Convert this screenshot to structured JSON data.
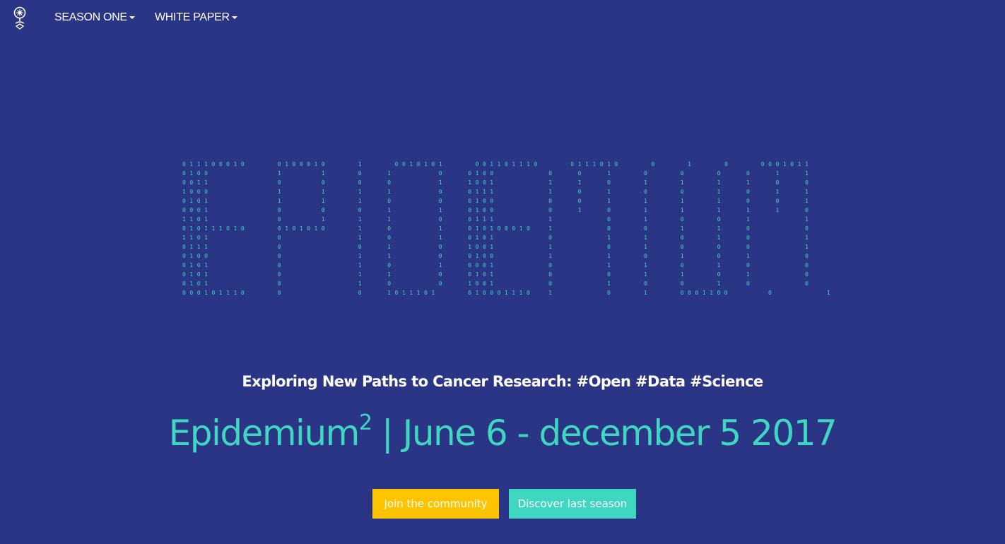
{
  "navbar": {
    "logo_icon": "epidemium-logo-icon",
    "items": [
      {
        "label": "SEASON ONE",
        "icon": "caret-down-icon"
      },
      {
        "label": "WHITE PAPER",
        "icon": "caret-down-icon"
      }
    ]
  },
  "hero": {
    "binary_rows": [
      "011100010    0100010    1    0010101    001101110    0111010    0    1    0    0001011",
      "0100         1     1    0   1      0   0100       0   0   1    0    0    0   0   1   1",
      "0011         0     0    0   0      1   1001       1   1   0    1    1    1   1   0   0",
      "1000         1     1    1   1      0   0111       1   0   1    0    0    1   0   1   1",
      "0101         1     1    1   0      0   0100       0   0   1    1    1    1   0   0   1",
      "0001         0     0    0   1      1   0100       0   1   0    1    1    1   1   1   0",
      "1101         0     1    1   1      0   0111       1       0    1    0    0   1       1",
      "010111010    0101010    1   0      1   010100010  1       0    0    1    1   0       0",
      "1101         0          1   0      1   0101       0       1    1    0    1   0       1",
      "0111         0          0   1      0   1001       1       0    1    0    0   0       1",
      "0100         0          1   1      0   0100       1       1    0    1    0   1       0",
      "0101         0          1   0      1   0001       0       1    1    0    1   0       0",
      "0101         0          1   1      0   0101       0       0    1    1    0   1       0",
      "0101         0          1   0      0   1001       0       1    0    0    1   0       0",
      "000101110    0          0   1011101    010001110  1       0    1    0001100     0       1"
    ],
    "tagline": "Exploring New Paths to Cancer Research: #Open #Data #Science",
    "headline_main": "Epidemium",
    "headline_sup": "2",
    "headline_rest": " | June 6 - december 5 2017"
  },
  "actions": {
    "join_label": "Join the community",
    "discover_label": "Discover last season"
  },
  "colors": {
    "background": "#2a3585",
    "accent": "#3fd7c0",
    "join_button": "#ffc400",
    "text": "#ffffff"
  }
}
